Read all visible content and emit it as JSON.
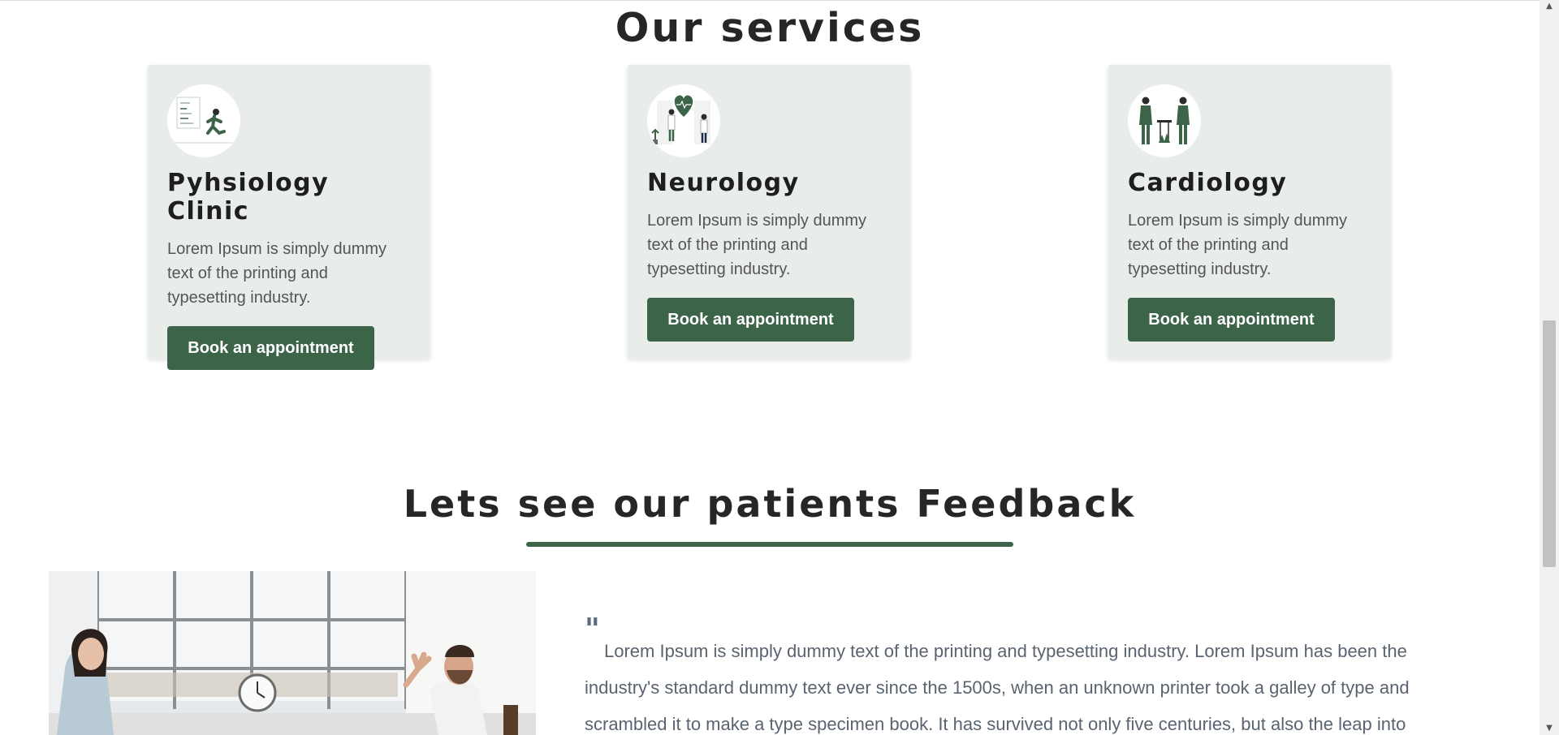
{
  "services": {
    "title": "Our services",
    "cards": [
      {
        "icon": "physiology-runner-icon",
        "title": "Pyhsiology Clinic",
        "text": "Lorem Ipsum is simply dummy text of the printing and typesetting industry.",
        "button": "Book an appointment"
      },
      {
        "icon": "neurology-doctors-heart-icon",
        "title": "Neurology",
        "text": "Lorem Ipsum is simply dummy text of the printing and typesetting industry.",
        "button": "Book an appointment"
      },
      {
        "icon": "cardiology-nurses-icon",
        "title": "Cardiology",
        "text": "Lorem Ipsum is simply dummy text of the printing and typesetting industry.",
        "button": "Book an appointment"
      }
    ]
  },
  "feedback": {
    "title": "Lets see our patients Feedback",
    "quote_mark": "\"",
    "quote": "Lorem Ipsum is simply dummy text of the printing and typesetting industry. Lorem Ipsum has been the industry's standard dummy text ever since the 1500s, when an unknown printer took a galley of type and scrambled it to make a type specimen book. It has survived not only five centuries, but also the leap into"
  },
  "colors": {
    "accent": "#3b6448",
    "card_bg": "#e9edea",
    "heading": "#262626"
  }
}
